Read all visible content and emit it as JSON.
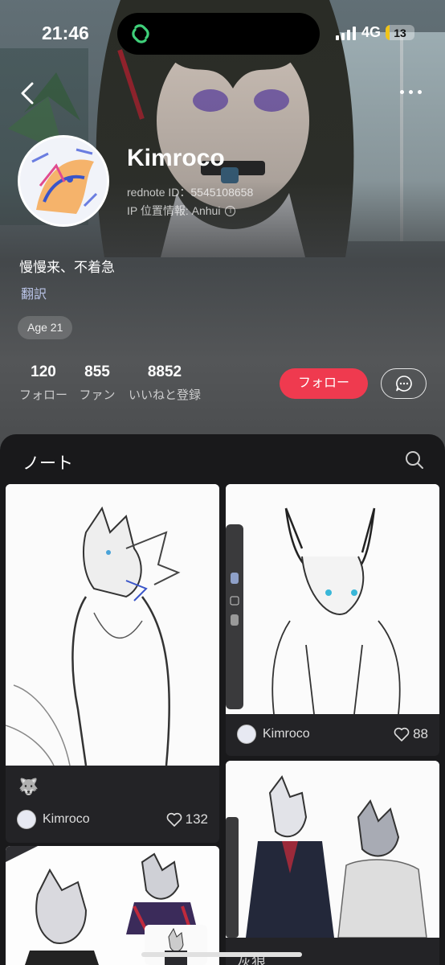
{
  "status_bar": {
    "time": "21:46",
    "network": "4G",
    "battery_level": "13",
    "battery_fraction": 0.13
  },
  "profile": {
    "username": "Kimroco",
    "rednote_id": "rednote ID：5545108658",
    "ip_location": "IP 位置情報: Anhui",
    "bio": "慢慢来、不着急",
    "translate_label": "翻訳",
    "age_badge": "Age 21"
  },
  "stats": [
    {
      "value": "120",
      "label": "フォロー"
    },
    {
      "value": "855",
      "label": "ファン"
    },
    {
      "value": "8852",
      "label": "いいねと登録"
    }
  ],
  "actions": {
    "follow_label": "フォロー"
  },
  "notes": {
    "title": "ノート",
    "cards": [
      {
        "emoji": "🐺",
        "author": "Kimroco",
        "likes": "132"
      },
      {
        "author": "Kimroco",
        "likes": "88"
      },
      {
        "title_partial": "灰狼"
      }
    ]
  },
  "colors": {
    "accent": "#ef3a4f",
    "panel": "#19191b",
    "card": "#232326"
  },
  "icons": [
    "back-icon",
    "more-icon",
    "message-icon",
    "search-icon",
    "heart-icon",
    "info-icon",
    "app-link-icon"
  ]
}
